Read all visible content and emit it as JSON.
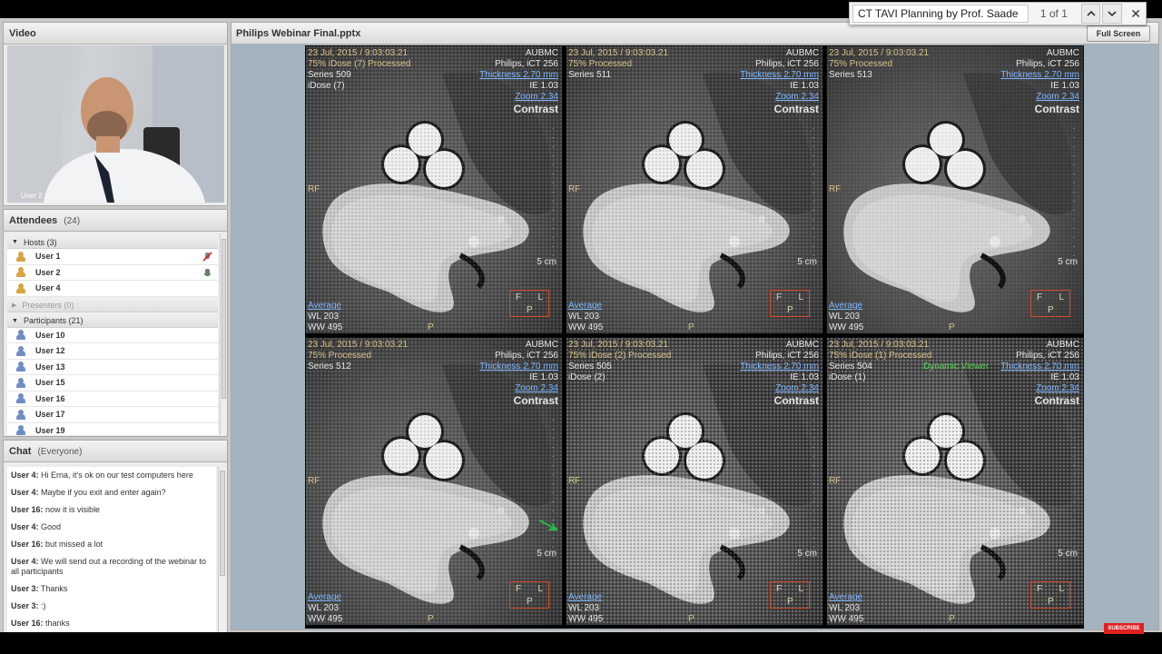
{
  "find_bar": {
    "query": "CT TAVI Planning by Prof. Saade",
    "count": "1 of 1",
    "prev_icon": "chevron-up-icon",
    "next_icon": "chevron-down-icon",
    "close_icon": "close-icon"
  },
  "video_pod": {
    "title": "Video",
    "user_label": "User 2"
  },
  "attendees": {
    "title": "Attendees",
    "count": "(24)",
    "hosts_label": "Hosts (3)",
    "hosts": [
      {
        "name": "User 1",
        "status_icon": "microphone-muted-icon"
      },
      {
        "name": "User 2",
        "status_icon": "microphone-active-icon"
      },
      {
        "name": "User 4",
        "status_icon": ""
      }
    ],
    "presenters_label": "Presenters (0)",
    "participants_label": "Participants (21)",
    "participants": [
      "User 10",
      "User 12",
      "User 13",
      "User 15",
      "User 16",
      "User 17",
      "User 19"
    ]
  },
  "chat": {
    "title": "Chat",
    "scope": "(Everyone)",
    "messages": [
      {
        "author": "User 4:",
        "text": "Hi Erna, it's ok on our test computers here"
      },
      {
        "author": "User 4:",
        "text": "Maybe if you exit and enter again?"
      },
      {
        "author": "User 16:",
        "text": "now it is visible"
      },
      {
        "author": "User 4:",
        "text": "Good"
      },
      {
        "author": "User 16:",
        "text": "but missed a lot"
      },
      {
        "author": "User 4:",
        "text": "We will send out a recording of the webinar to all participants"
      },
      {
        "author": "User 3:",
        "text": "Thanks"
      },
      {
        "author": "User 3:",
        "text": ":)"
      },
      {
        "author": "User 16:",
        "text": "thanks"
      }
    ]
  },
  "share_pod": {
    "title": "Philips Webinar Final.pptx",
    "fullscreen_label": "Full Screen"
  },
  "ct_panels": [
    {
      "date": "23 Jul, 2015 / 9:03:03.21",
      "institution": "AUBMC",
      "proc": "75% iDose (7) Processed",
      "scanner": "Philips, iCT 256",
      "series": "Series 509",
      "thickness": "Thickness 2.70 mm",
      "dose": "iDose (7)",
      "ie": "IE 1.03",
      "zoom": "Zoom 2.34",
      "contrast": "Contrast",
      "rf": "RF",
      "scale": "5 cm",
      "avg": "Average",
      "wl": "WL 203",
      "ww": "WW 495",
      "p": "P",
      "viewer": ""
    },
    {
      "date": "23 Jul, 2015 / 9:03:03.21",
      "institution": "AUBMC",
      "proc": "75% Processed",
      "scanner": "Philips, iCT 256",
      "series": "Series 511",
      "thickness": "Thickness 2.70 mm",
      "dose": "",
      "ie": "IE 1.03",
      "zoom": "Zoom 2.34",
      "contrast": "Contrast",
      "rf": "RF",
      "scale": "5 cm",
      "avg": "Average",
      "wl": "WL 203",
      "ww": "WW 495",
      "p": "P",
      "viewer": ""
    },
    {
      "date": "23 Jul, 2015 / 9:03:03.21",
      "institution": "AUBMC",
      "proc": "75% Processed",
      "scanner": "Philips, iCT 256",
      "series": "Series 513",
      "thickness": "Thickness 2.70 mm",
      "dose": "",
      "ie": "IE 1.03",
      "zoom": "Zoom 2.34",
      "contrast": "Contrast",
      "rf": "RF",
      "scale": "5 cm",
      "avg": "Average",
      "wl": "WL 203",
      "ww": "WW 495",
      "p": "P",
      "viewer": ""
    },
    {
      "date": "23 Jul, 2015 / 9:03:03.21",
      "institution": "AUBMC",
      "proc": "75% Processed",
      "scanner": "Philips, iCT 256",
      "series": "Series 512",
      "thickness": "Thickness 2.70 mm",
      "dose": "",
      "ie": "IE 1.03",
      "zoom": "Zoom 2.34",
      "contrast": "Contrast",
      "rf": "RF",
      "scale": "5 cm",
      "avg": "Average",
      "wl": "WL 203",
      "ww": "WW 495",
      "p": "P",
      "viewer": ""
    },
    {
      "date": "23 Jul, 2015 / 9:03:03.21",
      "institution": "AUBMC",
      "proc": "75% iDose (2) Processed",
      "scanner": "Philips, iCT 256",
      "series": "Series 505",
      "thickness": "Thickness 2.70 mm",
      "dose": "iDose (2)",
      "ie": "IE 1.03",
      "zoom": "Zoom 2.34",
      "contrast": "Contrast",
      "rf": "RF",
      "scale": "5 cm",
      "avg": "Average",
      "wl": "WL 203",
      "ww": "WW 495",
      "p": "P",
      "viewer": ""
    },
    {
      "date": "23 Jul, 2015 / 9:03:03.21",
      "institution": "AUBMC",
      "proc": "75% iDose (1) Processed",
      "scanner": "Philips, iCT 256",
      "series": "Series 504",
      "thickness": "Thickness 2.70 mm",
      "dose": "iDose (1)",
      "ie": "IE 1.03",
      "zoom": "Zoom 2.34",
      "contrast": "Contrast",
      "rf": "RF",
      "scale": "5 cm",
      "avg": "Average",
      "wl": "WL 203",
      "ww": "WW 495",
      "p": "P",
      "viewer": "Dynamic Viewer"
    }
  ],
  "orientation": {
    "f": "F",
    "l": "L",
    "p": "P"
  },
  "youtube_badge": "SUBSCRIBE",
  "colors": {
    "accent_blue": "#7db6ff",
    "overlay_yellow": "#d8c28a",
    "frame_red": "#d34a2a",
    "subscribe_red": "#e02020"
  }
}
